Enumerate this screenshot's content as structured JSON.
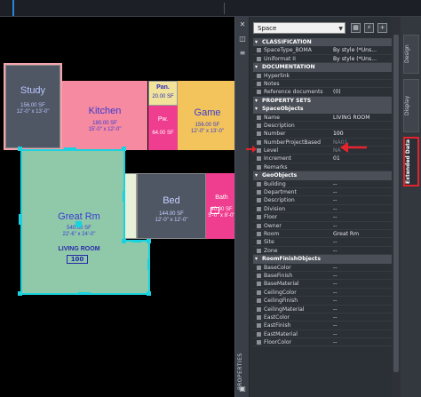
{
  "canvas": {
    "rooms": {
      "study": {
        "name": "Study",
        "area": "156.00 SF",
        "dims": "12'-0\" x 13'-0\""
      },
      "kitchen": {
        "name": "Kitchen",
        "area": "180.00 SF",
        "dims": "15'-0\" x 12'-0\""
      },
      "pantry": {
        "name": "Pan.",
        "area": "20.00 SF"
      },
      "pantry2": {
        "name": "Pw.",
        "area": "64.00 SF"
      },
      "game": {
        "name": "Game",
        "area": "156.00 SF",
        "dims": "12'-0\" x 13'-0\""
      },
      "great_rm": {
        "name": "Great Rm",
        "area": "540.00 SF",
        "dims": "22'-6\" x 24'-0\"",
        "tag_name": "LIVING ROOM",
        "tag_number": "100"
      },
      "bed": {
        "name": "Bed",
        "area": "144.00 SF",
        "dims": "12'-0\" x 12'-0\""
      },
      "bath": {
        "name": "Bath",
        "area": "40.00 SF",
        "dims": "5'-0\" x 8'-0\""
      }
    }
  },
  "palette": {
    "object_type": "Space",
    "title": "PROPERTIES",
    "tabs": {
      "design": "Design",
      "display": "Display",
      "extended": "Extended Data"
    },
    "rows": [
      {
        "kind": "cat",
        "label": "CLASSIFICATION"
      },
      {
        "kind": "prop",
        "label": "SpaceType_BOMA",
        "value": "By style (*Uns..."
      },
      {
        "kind": "prop",
        "label": "Uniformat II",
        "value": "By style (*Uns..."
      },
      {
        "kind": "cat",
        "label": "DOCUMENTATION"
      },
      {
        "kind": "prop",
        "label": "Hyperlink",
        "value": ""
      },
      {
        "kind": "prop",
        "label": "Notes",
        "value": ""
      },
      {
        "kind": "prop",
        "label": "Reference documents",
        "value": "(0)"
      },
      {
        "kind": "cat",
        "label": "PROPERTY SETS"
      },
      {
        "kind": "cat",
        "label": "SpaceObjects"
      },
      {
        "kind": "prop",
        "label": "Name",
        "value": "LIVING ROOM"
      },
      {
        "kind": "prop",
        "label": "Description",
        "value": ""
      },
      {
        "kind": "prop",
        "label": "Number",
        "value": "100",
        "highlight": true
      },
      {
        "kind": "prop",
        "label": "NumberProjectBased",
        "value": "NA01",
        "dim": true
      },
      {
        "kind": "prop",
        "label": "Level",
        "value": "NA",
        "dim": true
      },
      {
        "kind": "prop",
        "label": "Increment",
        "value": "01"
      },
      {
        "kind": "prop",
        "label": "Remarks",
        "value": ""
      },
      {
        "kind": "cat",
        "label": "GeoObjects"
      },
      {
        "kind": "prop",
        "label": "Building",
        "value": "--"
      },
      {
        "kind": "prop",
        "label": "Department",
        "value": "--"
      },
      {
        "kind": "prop",
        "label": "Description",
        "value": "--"
      },
      {
        "kind": "prop",
        "label": "Division",
        "value": "--"
      },
      {
        "kind": "prop",
        "label": "Floor",
        "value": "--"
      },
      {
        "kind": "prop",
        "label": "Owner",
        "value": "--"
      },
      {
        "kind": "prop",
        "label": "Room",
        "value": "Great Rm"
      },
      {
        "kind": "prop",
        "label": "Site",
        "value": "--"
      },
      {
        "kind": "prop",
        "label": "Zone",
        "value": "--"
      },
      {
        "kind": "cat",
        "label": "RoomFinishObjects"
      },
      {
        "kind": "prop",
        "label": "BaseColor",
        "value": "--"
      },
      {
        "kind": "prop",
        "label": "BaseFinish",
        "value": "--"
      },
      {
        "kind": "prop",
        "label": "BaseMaterial",
        "value": "--"
      },
      {
        "kind": "prop",
        "label": "CeilingColor",
        "value": "--"
      },
      {
        "kind": "prop",
        "label": "CeilingFinish",
        "value": "--"
      },
      {
        "kind": "prop",
        "label": "CeilingMaterial",
        "value": "--"
      },
      {
        "kind": "prop",
        "label": "EastColor",
        "value": "--"
      },
      {
        "kind": "prop",
        "label": "EastFinish",
        "value": "--"
      },
      {
        "kind": "prop",
        "label": "EastMaterial",
        "value": "--"
      },
      {
        "kind": "prop",
        "label": "FloorColor",
        "value": "--"
      }
    ]
  },
  "colors": {
    "selection_grip": "#19d3e0",
    "annotation_red": "#e4232b"
  }
}
